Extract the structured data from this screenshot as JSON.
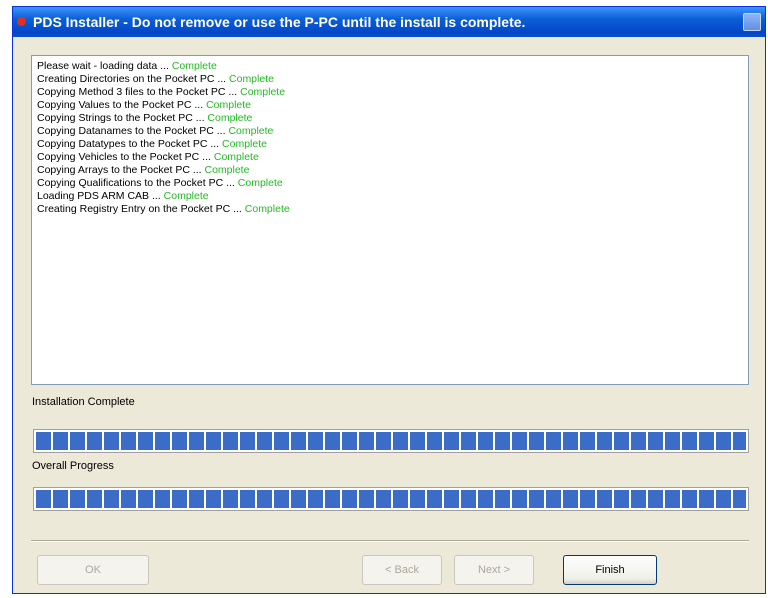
{
  "window": {
    "title": "PDS Installer - Do not remove or use the P-PC until the install is complete."
  },
  "log": {
    "lines": [
      {
        "text": "Please wait - loading data ...",
        "status": "Complete"
      },
      {
        "text": "Creating Directories on the Pocket PC ...",
        "status": "Complete"
      },
      {
        "text": "Copying Method 3 files to the Pocket PC ...",
        "status": "Complete"
      },
      {
        "text": "Copying Values to the Pocket PC ...",
        "status": "Complete"
      },
      {
        "text": "Copying Strings to the Pocket PC ...",
        "status": "Complete"
      },
      {
        "text": "Copying Datanames to the Pocket PC ...",
        "status": "Complete"
      },
      {
        "text": "Copying Datatypes to the Pocket PC ...",
        "status": "Complete"
      },
      {
        "text": "Copying Vehicles to the Pocket PC ...",
        "status": "Complete"
      },
      {
        "text": "Copying Arrays to the Pocket PC ...",
        "status": "Complete"
      },
      {
        "text": "Copying Qualifications to the Pocket PC ...",
        "status": "Complete"
      },
      {
        "text": "Loading PDS ARM CAB ...",
        "status": "Complete"
      },
      {
        "text": "Creating Registry Entry on the Pocket PC ...",
        "status": "Complete"
      }
    ]
  },
  "install_progress": {
    "label": "Installation Complete",
    "value": 1.0
  },
  "overall_progress": {
    "label": "Overall Progress",
    "value": 1.0
  },
  "buttons": {
    "ok": "OK",
    "back": "< Back",
    "next": "Next >",
    "finish": "Finish"
  },
  "colors": {
    "status_complete": "#22bb22",
    "progress_fill": "#3a6cc8",
    "titlebar": "#0a5fd6"
  },
  "icons": {
    "title": "app-icon",
    "close": "close-icon"
  }
}
